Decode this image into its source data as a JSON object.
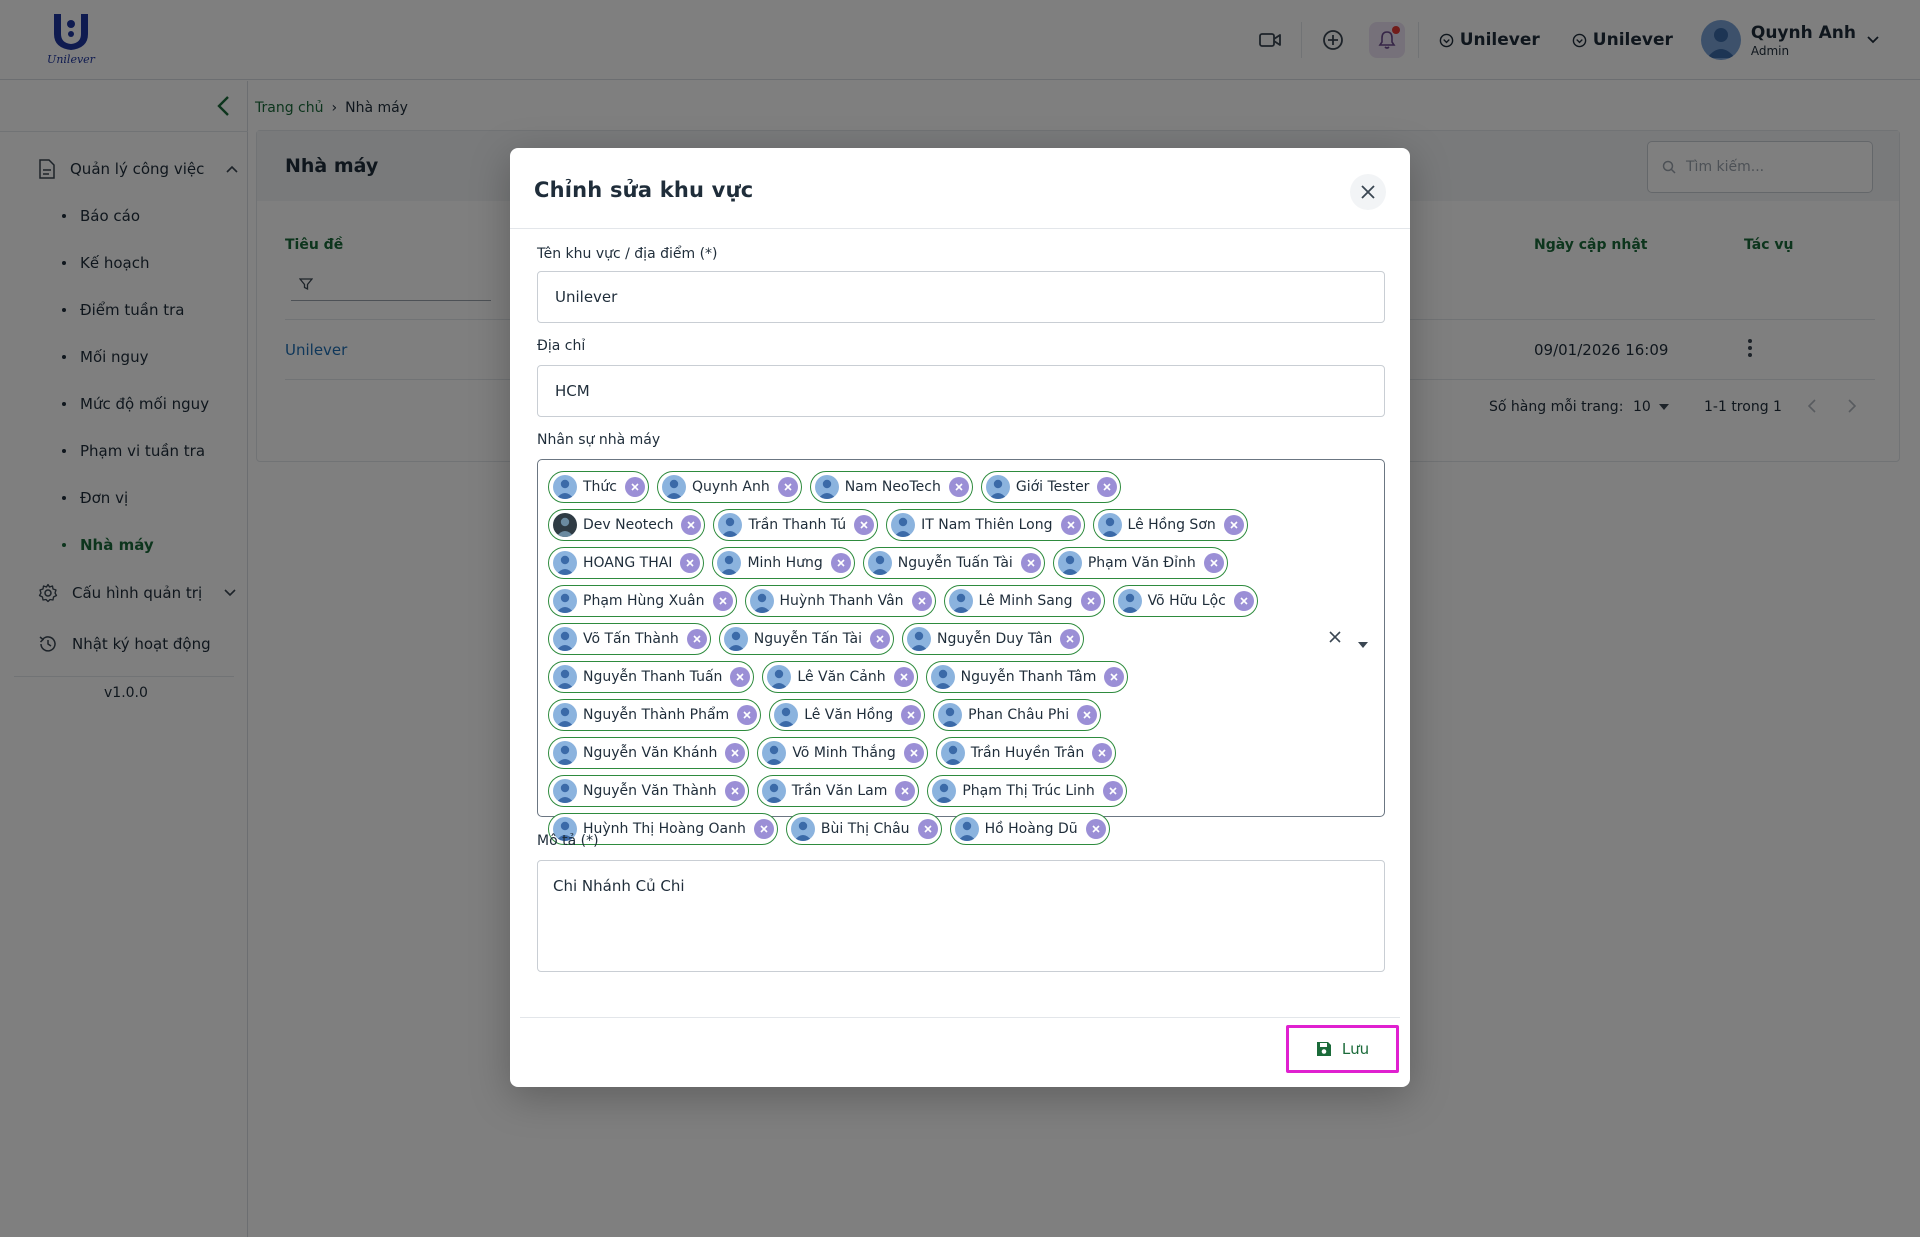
{
  "header": {
    "logo_text": "Unilever",
    "org_switch_1": "Unilever",
    "org_switch_2": "Unilever",
    "user_name": "Quynh Anh",
    "user_role": "Admin"
  },
  "sidebar": {
    "group_work": "Quản lý công việc",
    "items": [
      "Báo cáo",
      "Kế hoạch",
      "Điểm tuần tra",
      "Mối nguy",
      "Mức độ mối nguy",
      "Phạm vi tuần tra",
      "Đơn vị",
      "Nhà máy"
    ],
    "group_admin": "Cấu hình quản trị",
    "activity_log": "Nhật ký hoạt động",
    "version": "v1.0.0"
  },
  "breadcrumb": {
    "home": "Trang chủ",
    "current": "Nhà máy"
  },
  "page": {
    "title": "Nhà máy",
    "search_placeholder": "Tìm kiếm...",
    "col_title": "Tiêu đề",
    "col_updated": "Ngày cập nhật",
    "col_actions": "Tác vụ",
    "row_name": "Unilever",
    "row_updated": "09/01/2026 16:09",
    "rows_per_page_label": "Số hàng mỗi trang:",
    "rows_per_page": "10",
    "page_range": "1-1 trong 1"
  },
  "modal": {
    "title": "Chỉnh sửa khu vực",
    "name_label": "Tên khu vực / địa điểm (*)",
    "name_value": "Unilever",
    "address_label": "Địa chỉ",
    "address_value": "HCM",
    "staff_label": "Nhân sự nhà máy",
    "staff": [
      "Thức",
      "Quynh Anh",
      "Nam NeoTech",
      "Giới Tester",
      "Dev Neotech",
      "Trần Thanh Tú",
      "IT Nam Thiên Long",
      "Lê Hồng Sơn",
      "HOANG THAI",
      "Minh Hưng",
      "Nguyễn Tuấn Tài",
      "Phạm Văn Đỉnh",
      "Phạm Hùng Xuân",
      "Huỳnh Thanh Vân",
      "Lê Minh Sang",
      "Võ Hữu Lộc",
      "Võ Tấn Thành",
      "Nguyễn Tấn Tài",
      "Nguyễn Duy Tân",
      "Nguyễn Thanh Tuấn",
      "Lê Văn Cảnh",
      "Nguyễn Thanh Tâm",
      "Nguyễn Thành Phẩm",
      "Lê Văn Hồng",
      "Phan Châu Phi",
      "Nguyễn Văn Khánh",
      "Võ Minh Thắng",
      "Trần Huyền Trân",
      "Nguyễn Văn Thành",
      "Trần Văn Lam",
      "Phạm Thị Trúc Linh",
      "Huỳnh Thị Hoàng Oanh",
      "Bùi Thị Châu",
      "Hồ Hoàng Dũ"
    ],
    "description_label": "Mô tả (*)",
    "description_value": "Chi Nhánh Củ Chi",
    "save_label": "Lưu"
  },
  "colors": {
    "brand_green": "#1b6b3a",
    "chip_border": "#2e8b3e",
    "chip_remove": "#9b8fd6",
    "highlight": "#e020d0"
  }
}
